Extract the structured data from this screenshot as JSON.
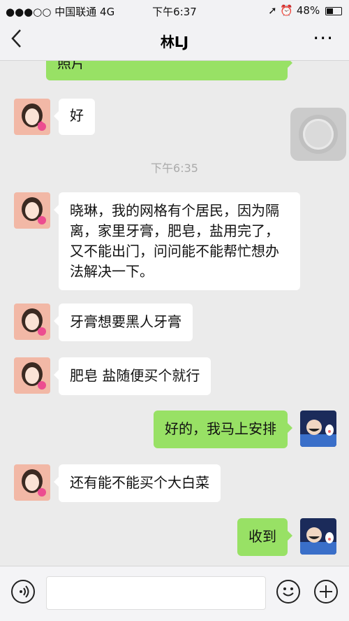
{
  "status_bar": {
    "signal": "●●●○○",
    "carrier": "中国联通",
    "network": "4G",
    "time": "下午6:37",
    "icons": "➚ ⏰",
    "battery": "48%"
  },
  "nav": {
    "back_icon": "chevron-left-icon",
    "title": "林LJ",
    "more": "···"
  },
  "chat": {
    "partial_message": "照片",
    "timestamp": "下午6:35",
    "messages": [
      {
        "side": "in",
        "text": "好"
      },
      {
        "side": "in",
        "text": "晓琳，我的网格有个居民，因为隔离，家里牙膏，肥皂，盐用完了，又不能出门，问问能不能帮忙想办法解决一下。"
      },
      {
        "side": "in",
        "text": "牙膏想要黑人牙膏"
      },
      {
        "side": "in",
        "text": "肥皂 盐随便买个就行"
      },
      {
        "side": "out",
        "text": "好的，我马上安排"
      },
      {
        "side": "in",
        "text": "还有能不能买个大白菜"
      },
      {
        "side": "out",
        "text": "收到"
      }
    ]
  },
  "input_bar": {
    "voice_icon": "voice-icon",
    "emoji_icon": "emoji-icon",
    "plus_icon": "plus-icon",
    "input_value": ""
  },
  "colors": {
    "outgoing_bubble": "#98e165",
    "incoming_bubble": "#ffffff",
    "background": "#ebebeb"
  }
}
